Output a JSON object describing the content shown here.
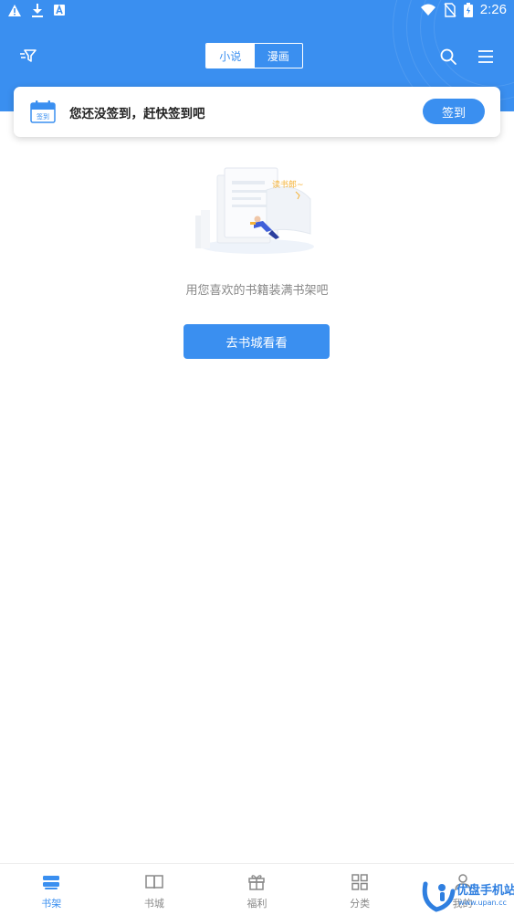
{
  "status_bar": {
    "time": "2:26",
    "left_icons": [
      "warning-icon",
      "download-icon",
      "app-notification-icon"
    ],
    "right_icons": [
      "wifi-icon",
      "no-sim-icon",
      "battery-icon"
    ]
  },
  "header": {
    "tabs": [
      {
        "label": "小说",
        "active": true
      },
      {
        "label": "漫画",
        "active": false
      }
    ],
    "icons": [
      "filter-icon",
      "search-icon",
      "menu-icon"
    ]
  },
  "checkin": {
    "message": "您还没签到，赶快签到吧",
    "button_label": "签到",
    "calendar_icon_label": "签到"
  },
  "empty_state": {
    "illustration_tag": "读书郎~",
    "message": "用您喜欢的书籍装满书架吧",
    "button_label": "去书城看看"
  },
  "bottom_nav": {
    "items": [
      {
        "label": "书架",
        "icon": "bookshelf-icon",
        "active": true
      },
      {
        "label": "书城",
        "icon": "open-book-icon",
        "active": false
      },
      {
        "label": "福利",
        "icon": "gift-icon",
        "active": false
      },
      {
        "label": "分类",
        "icon": "grid-icon",
        "active": false
      },
      {
        "label": "我的",
        "icon": "user-icon",
        "active": false
      }
    ]
  },
  "watermark": {
    "text": "优盘手机站",
    "url": "www.upan.cc"
  },
  "colors": {
    "accent": "#3a8ff0",
    "header_bg": "#3a8ff0",
    "text_dark": "#222222",
    "text_muted": "#888888"
  }
}
